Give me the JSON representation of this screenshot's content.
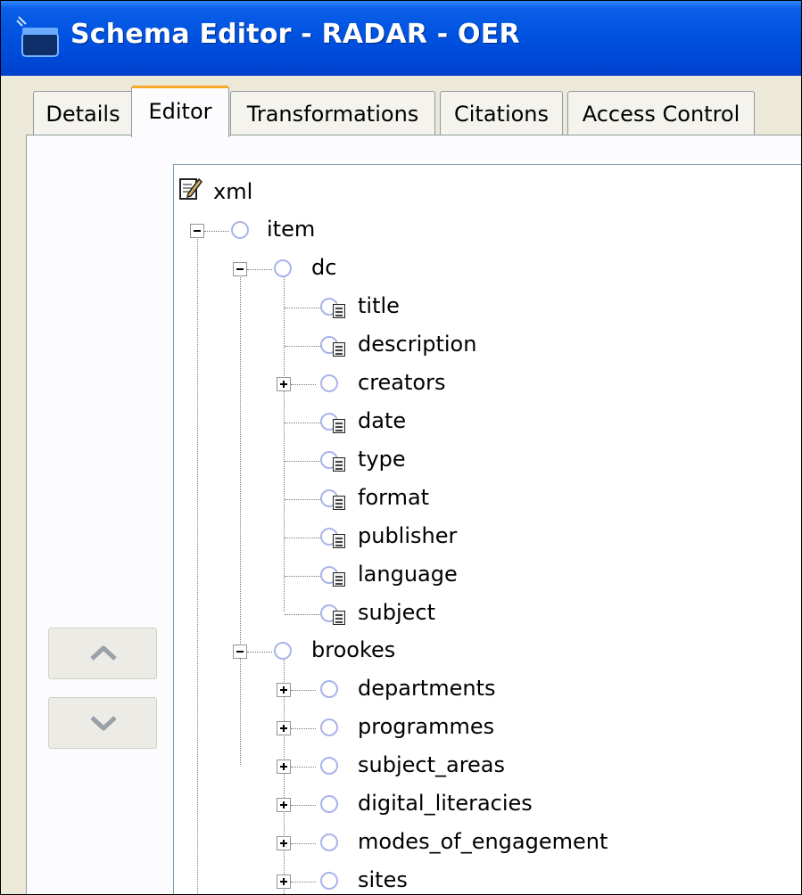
{
  "window": {
    "title": "Schema Editor - RADAR - OER"
  },
  "tabs": [
    {
      "label": "Details",
      "active": false
    },
    {
      "label": "Editor",
      "active": true
    },
    {
      "label": "Transformations",
      "active": false
    },
    {
      "label": "Citations",
      "active": false
    },
    {
      "label": "Access Control",
      "active": false
    }
  ],
  "buttons": {
    "move_up_icon": "chevron-up-icon",
    "move_down_icon": "chevron-down-icon"
  },
  "tree": {
    "root": "xml",
    "item": "item",
    "dc": {
      "label": "dc",
      "children": [
        "title",
        "description",
        "creators",
        "date",
        "type",
        "format",
        "publisher",
        "language",
        "subject"
      ]
    },
    "brookes": {
      "label": "brookes",
      "children": [
        "departments",
        "programmes",
        "subject_areas",
        "digital_literacies",
        "modes_of_engagement",
        "sites"
      ]
    }
  },
  "colors": {
    "titlebar": "#0052e0",
    "active_tab_accent": "#f7a826",
    "node_ring": "#a9b4ea"
  }
}
